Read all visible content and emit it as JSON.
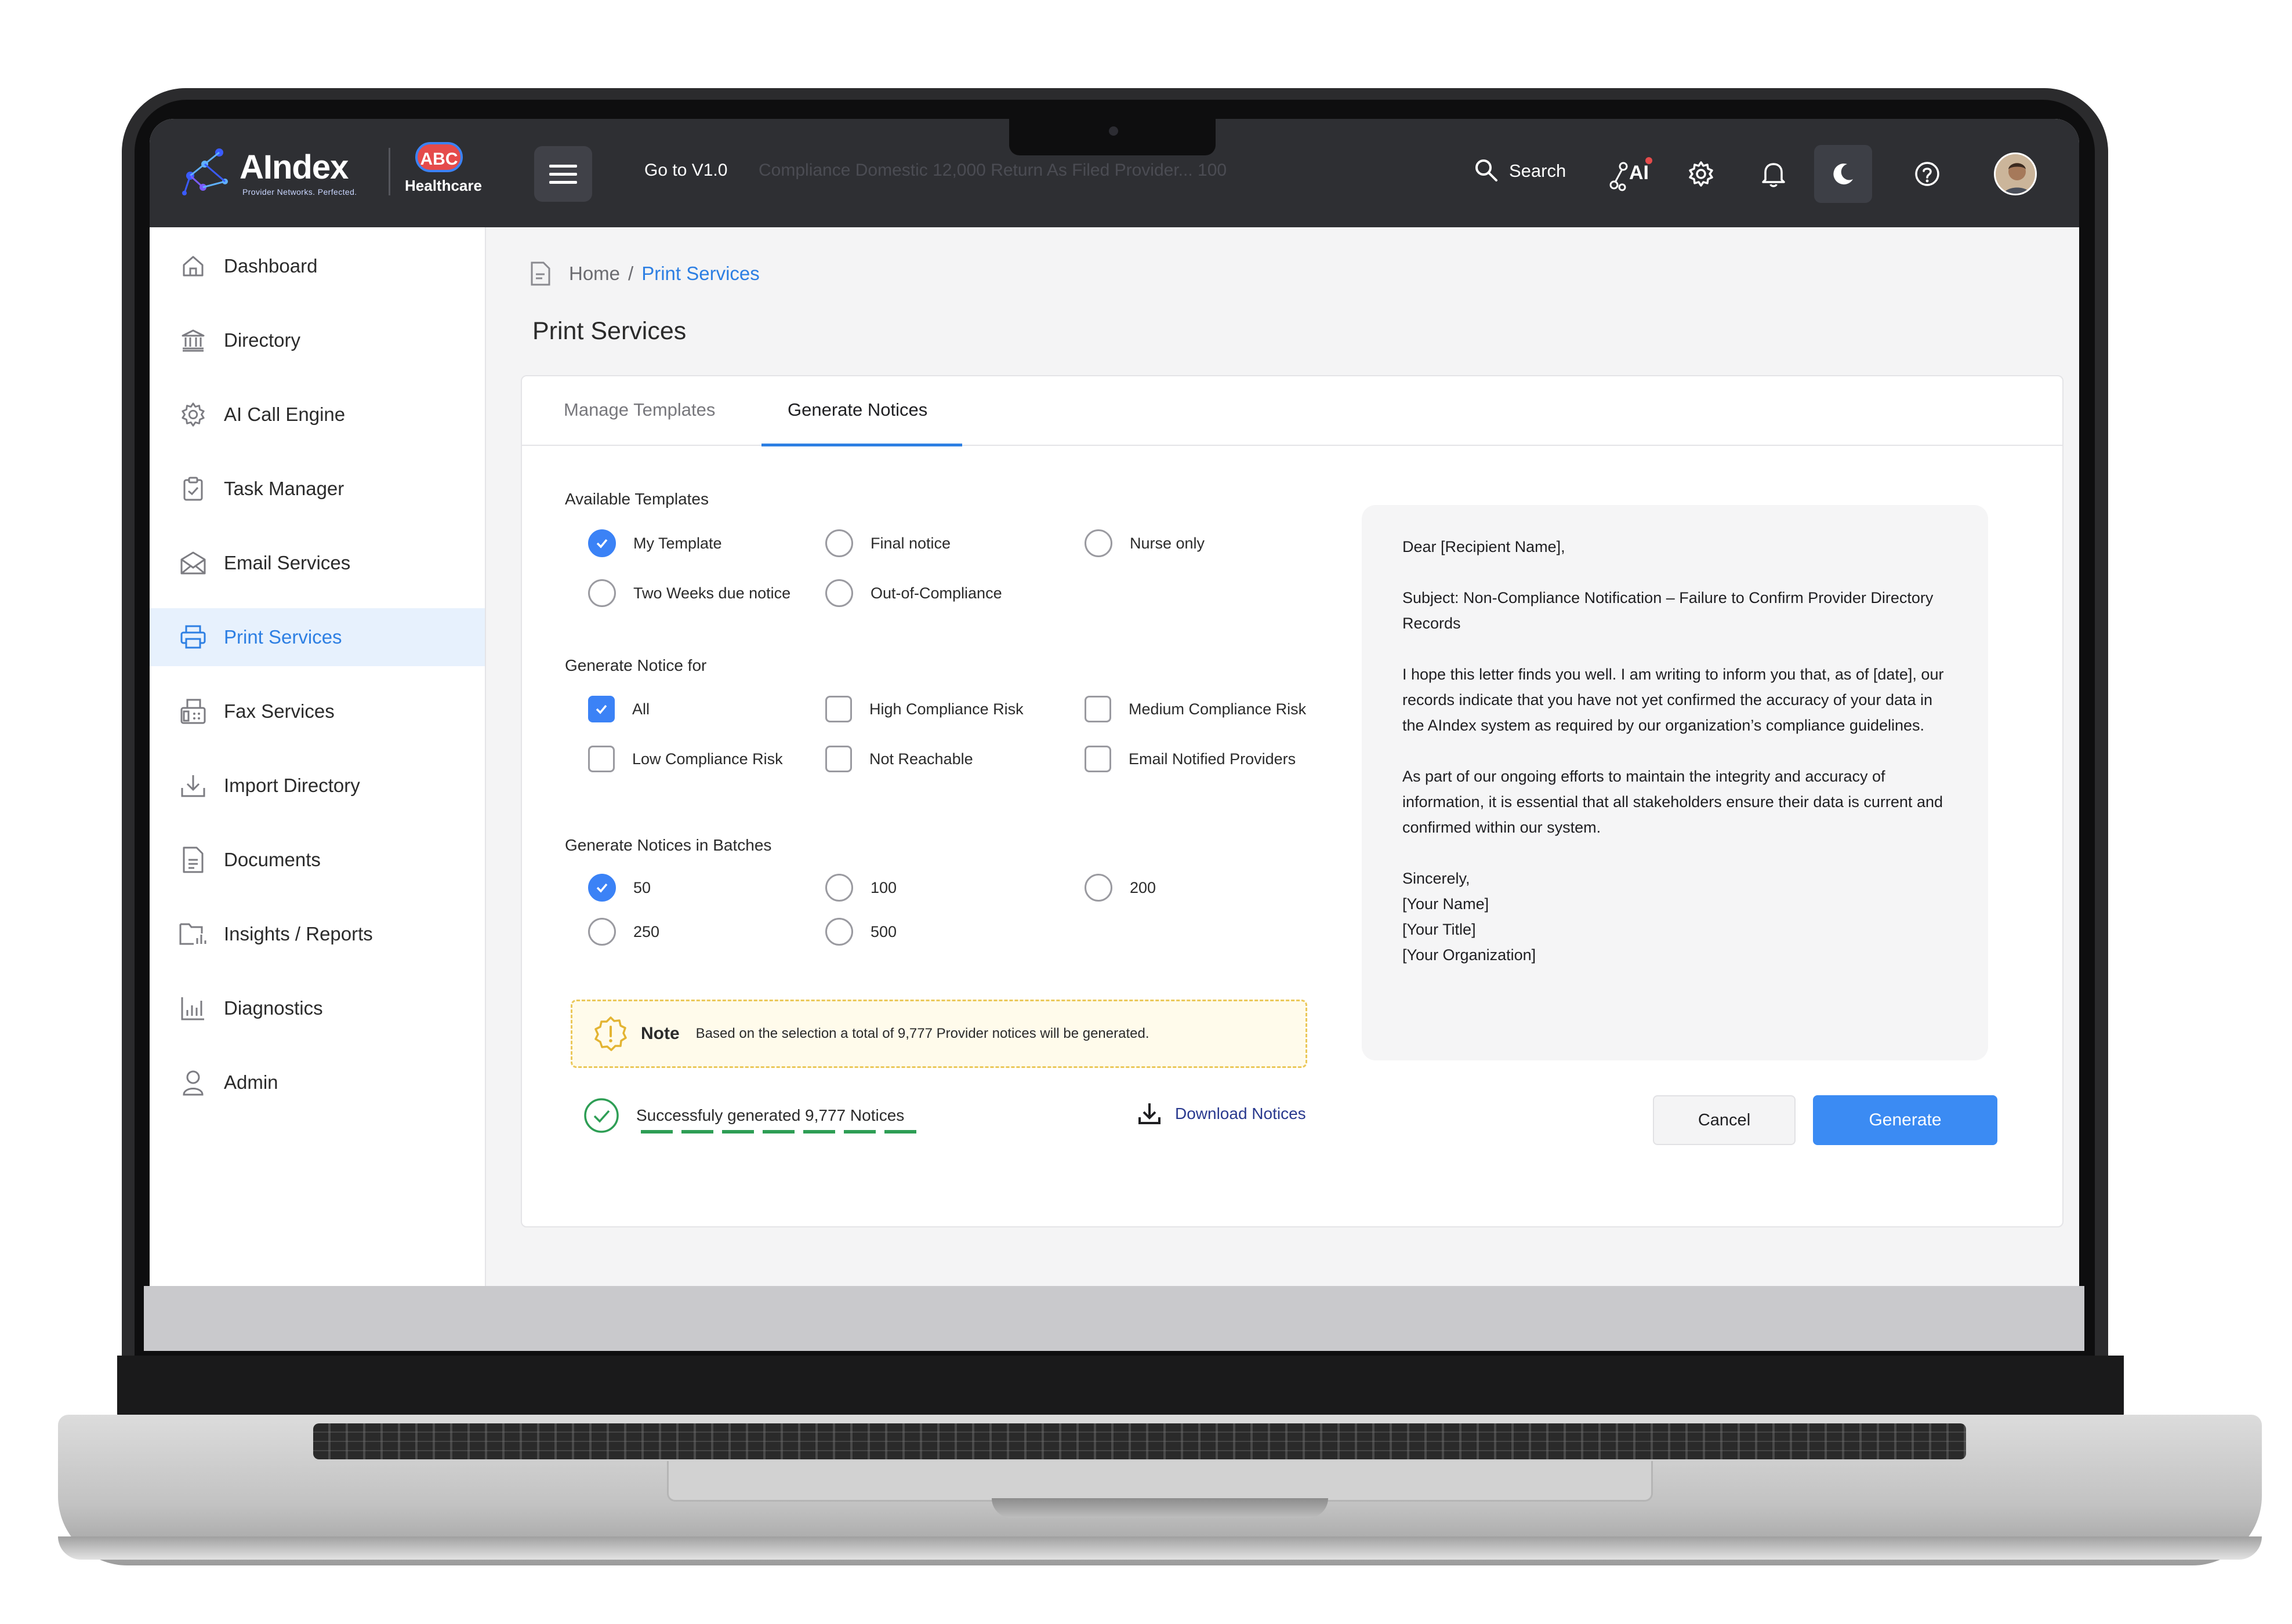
{
  "topbar": {
    "logo_text": "AIndex",
    "logo_tagline": "Provider Networks. Perfected.",
    "org_badge": "ABC",
    "org_name": "Healthcare",
    "goto_label": "Go to V1.0",
    "ticker_text": "Compliance Domestic 12,000 Return As Filed Provider... 100",
    "search_label": "Search",
    "ai_label": "AI"
  },
  "sidebar": {
    "items": [
      {
        "label": "Dashboard",
        "icon": "home-icon"
      },
      {
        "label": "Directory",
        "icon": "bank-icon"
      },
      {
        "label": "AI Call Engine",
        "icon": "gear-icon"
      },
      {
        "label": "Task Manager",
        "icon": "clipboard-icon"
      },
      {
        "label": "Email Services",
        "icon": "envelope-icon"
      },
      {
        "label": "Print Services",
        "icon": "printer-icon"
      },
      {
        "label": "Fax Services",
        "icon": "fax-icon"
      },
      {
        "label": "Import Directory",
        "icon": "download-tray-icon"
      },
      {
        "label": "Documents",
        "icon": "document-icon"
      },
      {
        "label": "Insights / Reports",
        "icon": "folder-chart-icon"
      },
      {
        "label": "Diagnostics",
        "icon": "bar-chart-icon"
      },
      {
        "label": "Admin",
        "icon": "user-icon"
      }
    ],
    "active": "Print Services"
  },
  "breadcrumb": {
    "home": "Home",
    "separator": "/",
    "current": "Print Services"
  },
  "page_title": "Print Services",
  "tabs": {
    "manage": "Manage Templates",
    "generate": "Generate Notices",
    "active": "Generate Notices"
  },
  "templates": {
    "label": "Available Templates",
    "options": [
      "My Template",
      "Final notice",
      "Nurse only",
      "Two Weeks due notice",
      "Out-of-Compliance"
    ],
    "selected": "My Template"
  },
  "notice_for": {
    "label": "Generate Notice for",
    "options": [
      "All",
      "High Compliance Risk",
      "Medium Compliance Risk",
      "Low Compliance Risk",
      "Not Reachable",
      "Email Notified Providers"
    ],
    "checked": [
      "All"
    ]
  },
  "batches": {
    "label": "Generate Notices in Batches",
    "options": [
      "50",
      "100",
      "200",
      "250",
      "500"
    ],
    "selected": "50"
  },
  "note": {
    "title": "Note",
    "message": "Based on the selection a total of 9,777 Provider notices will be generated."
  },
  "status": {
    "success_message": "Successfuly generated 9,777 Notices",
    "download_label": "Download Notices"
  },
  "preview": {
    "salutation": "Dear [Recipient Name],",
    "subject": "Subject: Non-Compliance Notification – Failure to Confirm Provider Directory Records",
    "paragraph1": "I hope this letter finds you well. I am writing to inform you that, as of [date], our records indicate  that you have not yet confirmed the accuracy of your data in the AIndex system as required by our organization’s compliance guidelines.",
    "paragraph2": "As part of our ongoing efforts to maintain the integrity and accuracy of information, it is essential  that all stakeholders ensure their data is current and confirmed within our system.",
    "closing": "Sincerely,",
    "name": "[Your Name]",
    "title": "[Your Title]",
    "organization": "[Your Organization]"
  },
  "actions": {
    "cancel": "Cancel",
    "generate": "Generate"
  },
  "colors": {
    "accent": "#3b82f6",
    "topbar": "#2e2f33",
    "success": "#2e9e55",
    "note_border": "#ebc85a"
  }
}
